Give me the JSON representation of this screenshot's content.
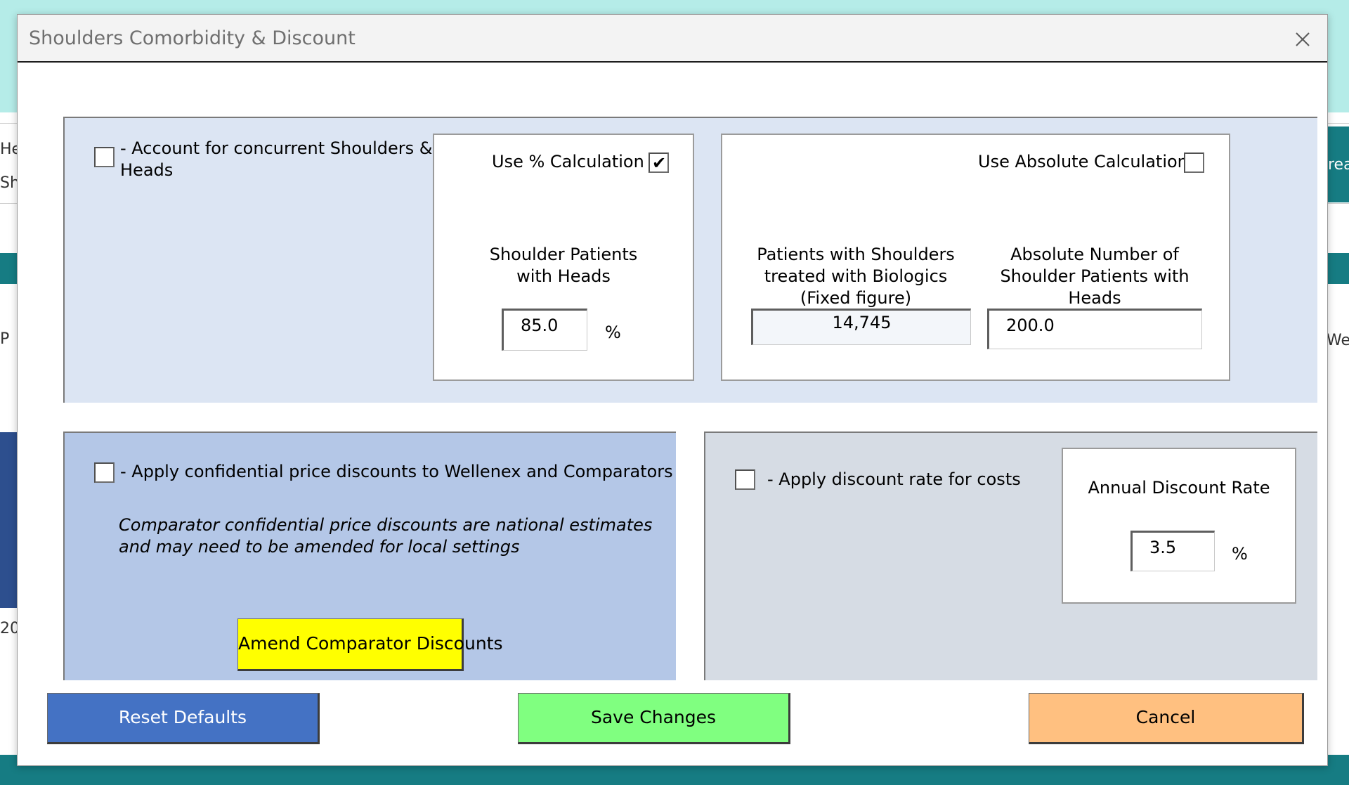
{
  "background": {
    "left_texts": [
      "Hea",
      "Sho",
      "P",
      "20"
    ],
    "right_texts": [
      "rea",
      "Wei"
    ]
  },
  "dialog": {
    "title": "Shoulders Comorbidity & Discount",
    "close_icon": "close-icon"
  },
  "comorbidity": {
    "account_label_line1": "- Account for concurrent Shoulders &",
    "account_label_line2": "Heads",
    "account_checked": false,
    "pct": {
      "label": "Use % Calculation",
      "checked": true,
      "field_label_line1": "Shoulder Patients",
      "field_label_line2": "with Heads",
      "value": "85.0",
      "unit": "%"
    },
    "abs": {
      "label": "Use Absolute Calculation",
      "checked": false,
      "fixed_label_line1": "Patients with Shoulders",
      "fixed_label_line2": "treated with Biologics",
      "fixed_label_line3": "(Fixed figure)",
      "fixed_value": "14,745",
      "abs_label_line1": "Absolute Number of",
      "abs_label_line2": "Shoulder Patients with",
      "abs_label_line3": "Heads",
      "abs_value": "200.0"
    }
  },
  "confidential": {
    "label": "- Apply confidential price discounts to Wellenex and Comparators",
    "checked": false,
    "note_line1": "Comparator confidential price discounts are national estimates",
    "note_line2": "and may need to be amended for local settings",
    "amend_button": "Amend Comparator Discounts"
  },
  "discount": {
    "label": "- Apply discount rate for costs",
    "checked": false,
    "rate_label": "Annual Discount Rate",
    "rate_value": "3.5",
    "unit": "%"
  },
  "buttons": {
    "reset": "Reset Defaults",
    "save": "Save Changes",
    "cancel": "Cancel"
  },
  "colors": {
    "top_frame": "#dce5f3",
    "confidential_frame": "#b4c7e7",
    "discount_frame": "#d6dce4",
    "amend_button": "#ffff00",
    "reset_button": "#4472c4",
    "save_button": "#80ff80",
    "cancel_button": "#ffc080"
  }
}
